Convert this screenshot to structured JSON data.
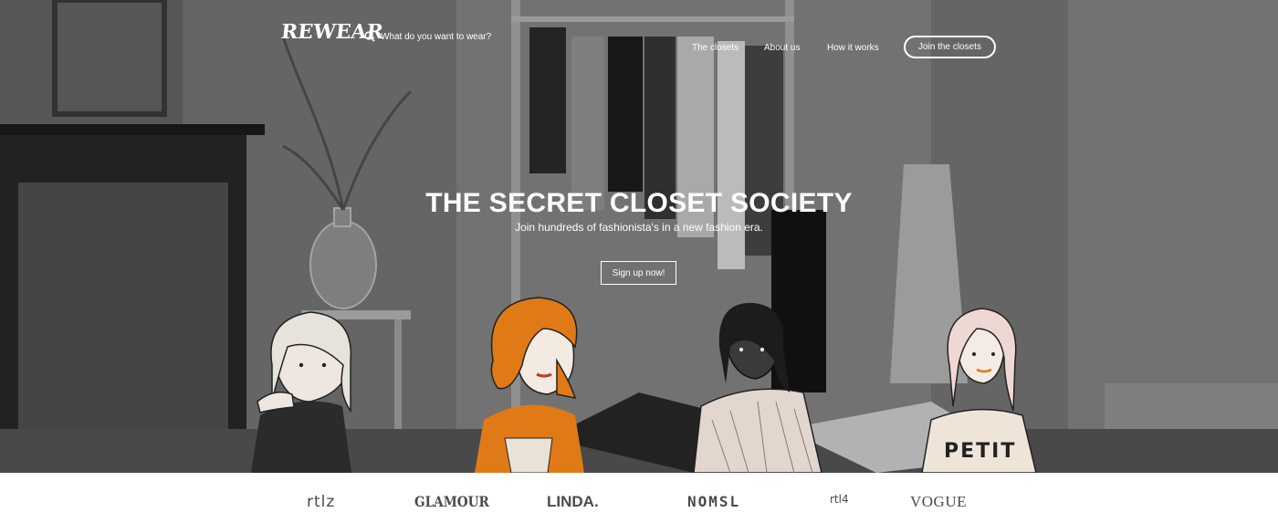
{
  "brand": {
    "logo_text": "REWEAR"
  },
  "search": {
    "placeholder": "What do you want to wear?",
    "icon": "search-icon"
  },
  "nav": {
    "items": [
      {
        "label": "The closets"
      },
      {
        "label": "About us"
      },
      {
        "label": "How it works"
      }
    ],
    "cta_label": "Join the closets"
  },
  "hero": {
    "title": "THE SECRET CLOSET SOCIETY",
    "subtitle": "Join hundreds of fashionista's in a new fashion era.",
    "button_label": "Sign up now!",
    "illustration_text": "PETIT"
  },
  "press": {
    "logos": [
      "rtlz",
      "GLAMOUR",
      "LINDA.",
      "NOMSL",
      "rtl4",
      "VOGUE"
    ]
  },
  "colors": {
    "accent_orange": "#e07a16",
    "text_white": "#ffffff",
    "press_gray": "#4a4a4a"
  }
}
